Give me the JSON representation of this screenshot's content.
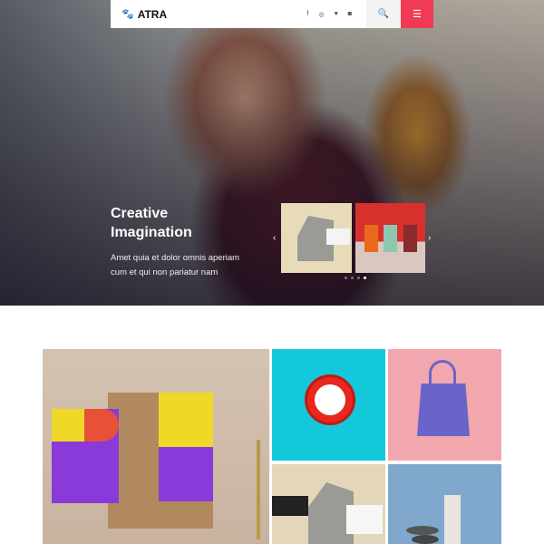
{
  "header": {
    "brand": "ATRA",
    "brand_icon": "paw-icon",
    "social": [
      {
        "icon": "facebook-icon",
        "glyph": "f"
      },
      {
        "icon": "pinterest-icon",
        "glyph": "◎"
      },
      {
        "icon": "twitter-icon",
        "glyph": "♥"
      },
      {
        "icon": "instagram-icon",
        "glyph": "◙"
      }
    ],
    "search_icon": "search-icon",
    "menu_icon": "hamburger-menu-icon"
  },
  "hero": {
    "title_line1": "Creative",
    "title_line2": "Imagination",
    "subtitle_line1": "Amet quia et dolor omnis aperiam",
    "subtitle_line2": "cum et qui non pariatur nam",
    "carousel": {
      "prev": "‹",
      "next": "›",
      "dots": 4,
      "active_dot": 4
    }
  },
  "colors": {
    "accent": "#f23a55",
    "cyan": "#14c8dc",
    "pink": "#f1a7ad",
    "blue": "#7fa8cc"
  }
}
